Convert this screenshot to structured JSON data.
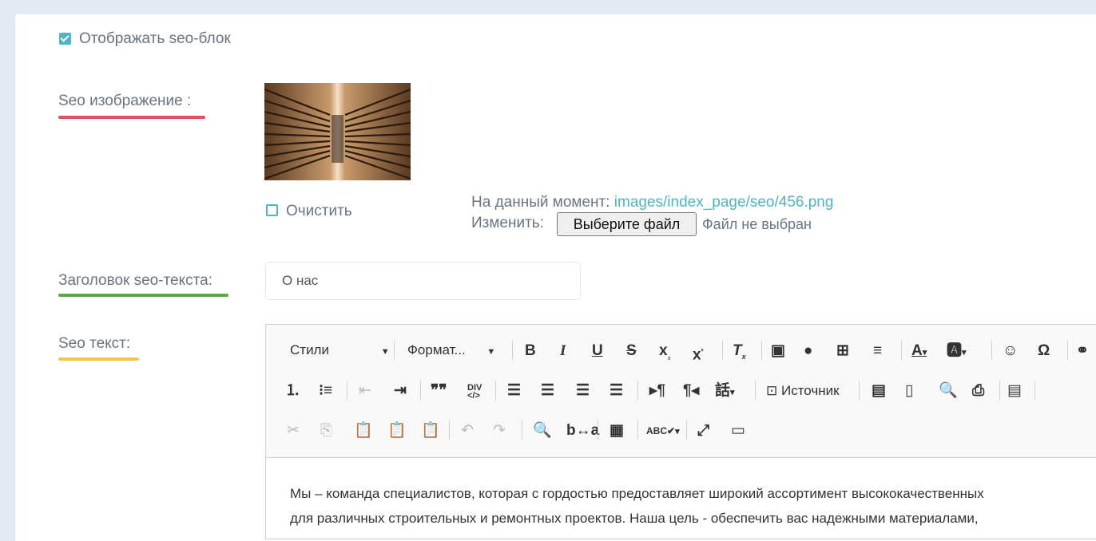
{
  "seo_block": {
    "show_label": "Отображать seo-блок",
    "checked": true
  },
  "seo_image": {
    "label": "Seo изображение :",
    "underline_color": "#e94f5a",
    "clear_label": "Очистить",
    "current_label": "На данный момент:",
    "current_path": "images/index_page/seo/456.png",
    "change_label": "Изменить:",
    "choose_file_button": "Выберите файл",
    "no_file_text": "Файл не выбран"
  },
  "seo_title": {
    "label": "Заголовок seo-текста:",
    "underline_color": "#5aa84a",
    "value": "О нас"
  },
  "seo_text": {
    "label": "Seo текст:",
    "underline_color": "#f3c24f",
    "toolbar": {
      "styles_combo": "Стили",
      "format_combo": "Формат...",
      "source_button": "Источник"
    },
    "content_lines": [
      "Мы – команда специалистов, которая с гордостью предоставляет широкий ассортимент высококачественных",
      "для различных строительных и ремонтных проектов. Наша цель - обеспечить вас надежными материалами,"
    ]
  },
  "colors": {
    "accent": "#4fb5bf",
    "link": "#4fb5bf"
  }
}
